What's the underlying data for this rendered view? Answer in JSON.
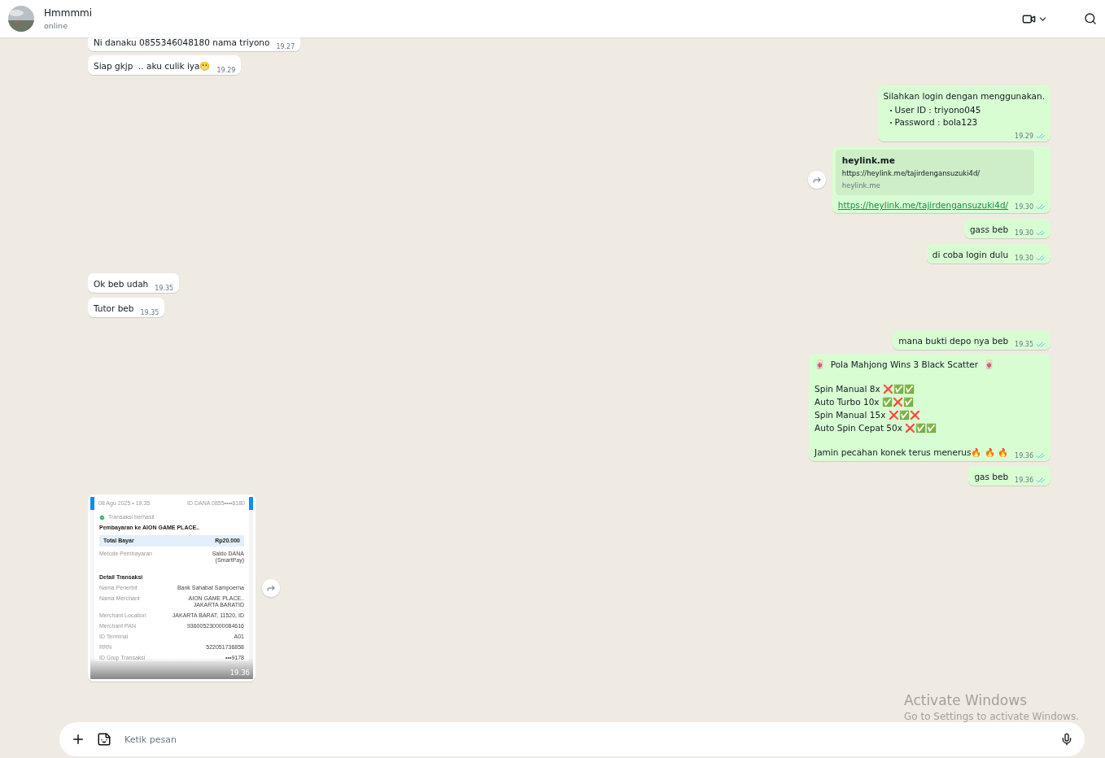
{
  "header": {
    "name": "Hmmmmi",
    "status": "online"
  },
  "messages": [
    {
      "kind": "text",
      "outgoing": false,
      "text": "Ni danaku 0855346048180 nama triyono",
      "time": "19.27"
    },
    {
      "kind": "text",
      "outgoing": false,
      "text": "Siap gkjp  .. aku culik iya😬",
      "time": "19.29"
    },
    {
      "kind": "list",
      "outgoing": true,
      "text": "Silahkan login dengan menggunakan.",
      "bullets": [
        "User ID : triyono045",
        "Password : bola123"
      ],
      "time": "19.29",
      "read": true
    },
    {
      "kind": "link",
      "outgoing": true,
      "preview": {
        "title": "heylink.me",
        "url": "https://heylink.me/tajirdengansuzuki4d/",
        "domain": "heylink.me"
      },
      "link": "https://heylink.me/tajirdengansuzuki4d/",
      "time": "19.30",
      "read": true,
      "forward_button": true
    },
    {
      "kind": "text",
      "outgoing": true,
      "text": "gass beb",
      "time": "19.30",
      "read": true
    },
    {
      "kind": "text",
      "outgoing": true,
      "text": "di coba login dulu",
      "time": "19.30",
      "read": true
    },
    {
      "kind": "text",
      "outgoing": false,
      "text": "Ok beb udah",
      "time": "19.35"
    },
    {
      "kind": "text",
      "outgoing": false,
      "text": "Tutor beb",
      "time": "19.35"
    },
    {
      "kind": "text",
      "outgoing": true,
      "text": "mana bukti depo nya beb",
      "time": "19.35",
      "read": true
    },
    {
      "kind": "pattern",
      "outgoing": true,
      "title": "🀄  Pola Mahjong Wins 3 Black Scatter  🀄",
      "rows": [
        "Spin Manual 8x ❌✅✅",
        "Auto Turbo 10x ✅❌✅",
        "Spin Manual 15x ❌✅❌",
        "Auto Spin Cepat 50x ❌✅✅"
      ],
      "footer": "Jamin pecahan konek terus menerus🔥 🔥 🔥",
      "time": "19.36",
      "read": true
    },
    {
      "kind": "text",
      "outgoing": true,
      "text": "gas beb",
      "time": "19.36",
      "read": true
    },
    {
      "kind": "image",
      "outgoing": false,
      "time": "19.36",
      "forward_button": true,
      "receipt": {
        "date": "08 Agu 2025 • 19:35",
        "account": "ID DANA 0855••••8180",
        "status": "Transaksi berhasil",
        "title": "Pembayaran ke AION GAME PLACE..",
        "total_label": "Total Bayar",
        "total": "Rp20.000",
        "method_label": "Metode Pembayaran",
        "method": "Saldo DANA (SmartPay)",
        "section": "Detail Transaksi",
        "rows": [
          {
            "label": "Nama Penerbit",
            "value": "Bank Sahabat Sampoerna"
          },
          {
            "label": "Nama Merchant",
            "value": "AION GAME PLACE.. JAKARTA BARATID"
          },
          {
            "label": "Merchant Location",
            "value": "JAKARTA BARAT, 11520, ID"
          },
          {
            "label": "Merchant PAN",
            "value": "936005230000084616"
          },
          {
            "label": "ID Terminal",
            "value": "A01"
          },
          {
            "label": "RRN",
            "value": "522051736858"
          },
          {
            "label": "ID Grup Transaksi",
            "value": "•••9178"
          }
        ]
      }
    }
  ],
  "composer": {
    "placeholder": "Ketik pesan"
  },
  "os_overlay": {
    "title": "Activate Windows",
    "subtitle": "Go to Settings to activate Windows."
  }
}
